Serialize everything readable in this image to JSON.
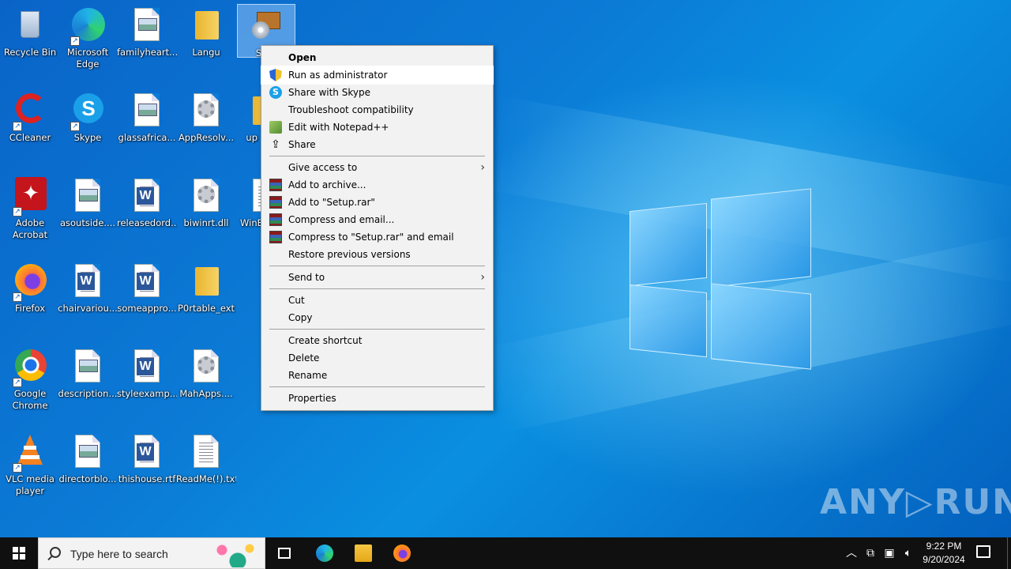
{
  "desktop": {
    "icons": [
      {
        "name": "recycle-bin",
        "label": "Recycle Bin",
        "icon": "recycle-bin-icon"
      },
      {
        "name": "microsoft-edge",
        "label": "Microsoft Edge",
        "icon": "edge-icon"
      },
      {
        "name": "familyheart",
        "label": "familyheart...",
        "icon": "image-file-icon"
      },
      {
        "name": "langu",
        "label": "Langu",
        "icon": "folder-icon"
      },
      {
        "name": "setup",
        "label": "Setu",
        "icon": "installer-icon"
      },
      {
        "name": "ccleaner",
        "label": "CCleaner",
        "icon": "ccleaner-icon"
      },
      {
        "name": "skype",
        "label": "Skype",
        "icon": "skype-icon"
      },
      {
        "name": "glassafrica",
        "label": "glassafrica...",
        "icon": "image-file-icon"
      },
      {
        "name": "appresolv",
        "label": "AppResolv...",
        "icon": "dll-file-icon"
      },
      {
        "name": "up",
        "label": "up",
        "icon": "folder-icon"
      },
      {
        "name": "adobe-acrobat",
        "label": "Adobe Acrobat",
        "icon": "acrobat-icon"
      },
      {
        "name": "asoutside",
        "label": "asoutside....",
        "icon": "image-file-icon"
      },
      {
        "name": "releasedord",
        "label": "releasedord...",
        "icon": "word-file-icon"
      },
      {
        "name": "biwinrt",
        "label": "biwinrt.dll",
        "icon": "dll-file-icon"
      },
      {
        "name": "wine",
        "label": "WinE",
        "icon": "text-file-icon"
      },
      {
        "name": "firefox",
        "label": "Firefox",
        "icon": "firefox-icon"
      },
      {
        "name": "chairvariou",
        "label": "chairvariou...",
        "icon": "word-file-icon"
      },
      {
        "name": "someappro",
        "label": "someappro...",
        "icon": "word-file-icon"
      },
      {
        "name": "p0rtable-ext",
        "label": "P0rtable_ext",
        "icon": "folder-icon"
      },
      {
        "name": "google-chrome",
        "label": "Google Chrome",
        "icon": "chrome-icon"
      },
      {
        "name": "description",
        "label": "description...",
        "icon": "image-file-icon"
      },
      {
        "name": "styleexamp",
        "label": "styleexamp...",
        "icon": "word-file-icon"
      },
      {
        "name": "mahapps",
        "label": "MahApps....",
        "icon": "dll-file-icon"
      },
      {
        "name": "vlc",
        "label": "VLC media player",
        "icon": "vlc-icon"
      },
      {
        "name": "directorblo",
        "label": "directorblo...",
        "icon": "image-file-icon"
      },
      {
        "name": "thishouse",
        "label": "thishouse.rtf",
        "icon": "word-file-icon"
      },
      {
        "name": "readme",
        "label": "ReadMe(!).txt",
        "icon": "text-file-icon"
      }
    ]
  },
  "context_menu": {
    "items": [
      {
        "label": "Open",
        "bold": true
      },
      {
        "label": "Run as administrator",
        "icon": "uac-shield-icon"
      },
      {
        "label": "Share with Skype",
        "icon": "skype-icon"
      },
      {
        "label": "Troubleshoot compatibility"
      },
      {
        "label": "Edit with Notepad++",
        "icon": "notepadpp-icon"
      },
      {
        "label": "Share",
        "icon": "share-icon"
      },
      {
        "label": "Give access to",
        "submenu": true
      },
      {
        "label": "Add to archive...",
        "icon": "winrar-icon"
      },
      {
        "label": "Add to \"Setup.rar\"",
        "icon": "winrar-icon"
      },
      {
        "label": "Compress and email...",
        "icon": "winrar-icon"
      },
      {
        "label": "Compress to \"Setup.rar\" and email",
        "icon": "winrar-icon"
      },
      {
        "label": "Restore previous versions"
      },
      {
        "label": "Send to",
        "submenu": true
      },
      {
        "label": "Cut"
      },
      {
        "label": "Copy"
      },
      {
        "label": "Create shortcut"
      },
      {
        "label": "Delete"
      },
      {
        "label": "Rename"
      },
      {
        "label": "Properties"
      }
    ],
    "hovered": "Run as administrator"
  },
  "taskbar": {
    "search_placeholder": "Type here to search",
    "pinned": [
      "task-view-icon",
      "edge-icon",
      "file-explorer-icon",
      "firefox-icon"
    ],
    "tray": {
      "time": "9:22 PM",
      "date": "9/20/2024"
    }
  },
  "watermark": "ANY▷RUN",
  "colors": {
    "accent": "#0078d7",
    "taskbar": "#101010",
    "menu_bg": "#f2f2f2"
  }
}
